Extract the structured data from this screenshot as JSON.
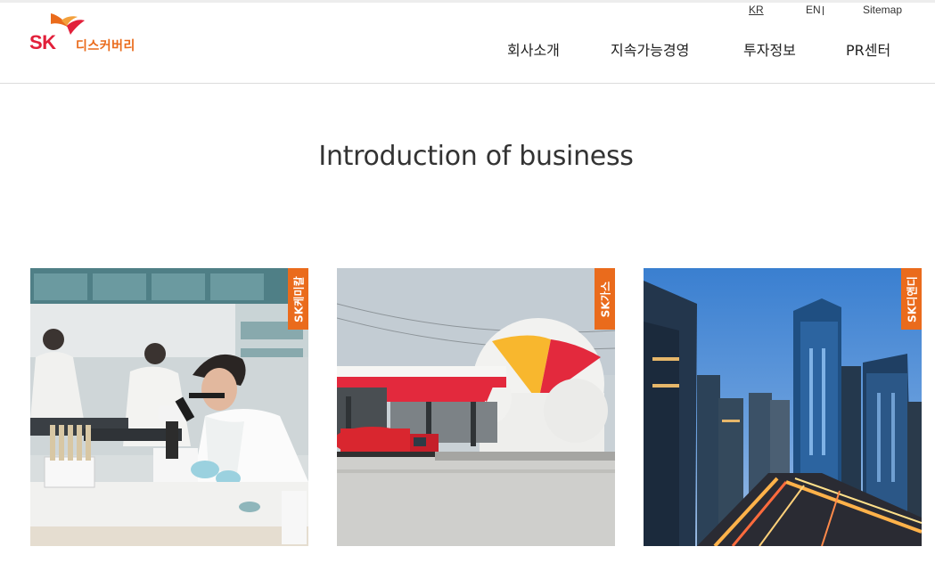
{
  "header": {
    "logo": {
      "mark": "SK",
      "name": "디스커버리"
    },
    "util": {
      "kr": "KR",
      "en": "EN",
      "sitemap": "Sitemap"
    },
    "nav": [
      {
        "label": "회사소개"
      },
      {
        "label": "지속가능경영"
      },
      {
        "label": "투자정보"
      },
      {
        "label": "PR센터"
      }
    ]
  },
  "main": {
    "title": "Introduction of business",
    "cards": [
      {
        "tag": "SK케미칼",
        "image": "laboratory-scientists-photo"
      },
      {
        "tag": "SK가스",
        "image": "gas-station-storage-tanks-photo"
      },
      {
        "tag": "SK디앤디",
        "image": "city-skyline-night-photo"
      }
    ]
  },
  "colors": {
    "accent_orange": "#ea6b1c",
    "brand_red": "#e2203a",
    "text_dark": "#333333",
    "divider": "#dcdcdc"
  }
}
